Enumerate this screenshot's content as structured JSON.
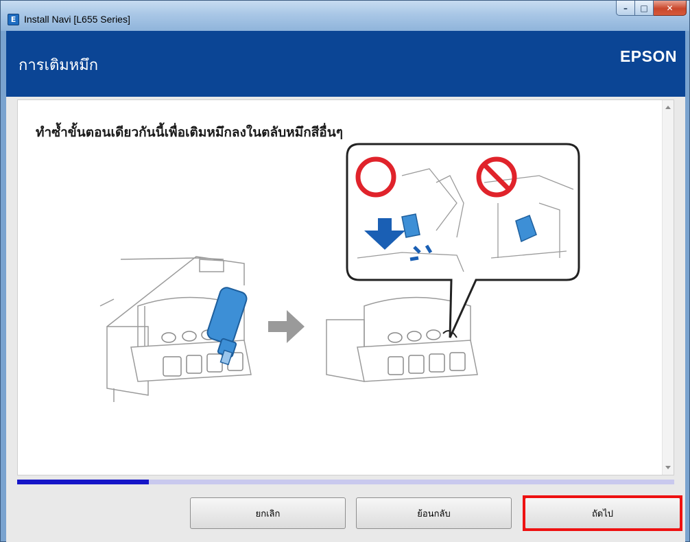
{
  "window": {
    "app_icon_letter": "E",
    "title": "Install Navi [L655 Series]",
    "controls": {
      "minimize": "–",
      "maximize": "□",
      "close": "✕"
    }
  },
  "header": {
    "title": "การเติมหมึก",
    "logo": "EPSON"
  },
  "content": {
    "instruction": "ทำซ้ำขั้นตอนเดียวกันนี้เพื่อเติมหมึกลงในตลับหมึกสีอื่นๆ",
    "illustration": {
      "left_image": "printer-ink-bottle-filling",
      "arrow": "right-arrow",
      "right_image": "printer-tank-cap-close",
      "callout_ok_icon": "circle-icon",
      "callout_ng_icon": "prohibited-icon"
    }
  },
  "progress": {
    "value": 0.2
  },
  "buttons": {
    "cancel": "ยกเลิก",
    "back": "ย้อนกลับ",
    "next": "ถัดไป"
  },
  "colors": {
    "header_bg": "#0b4595",
    "progress_fill": "#1616c8",
    "highlight": "#ee1111",
    "ink_blue": "#3d8fd6"
  }
}
